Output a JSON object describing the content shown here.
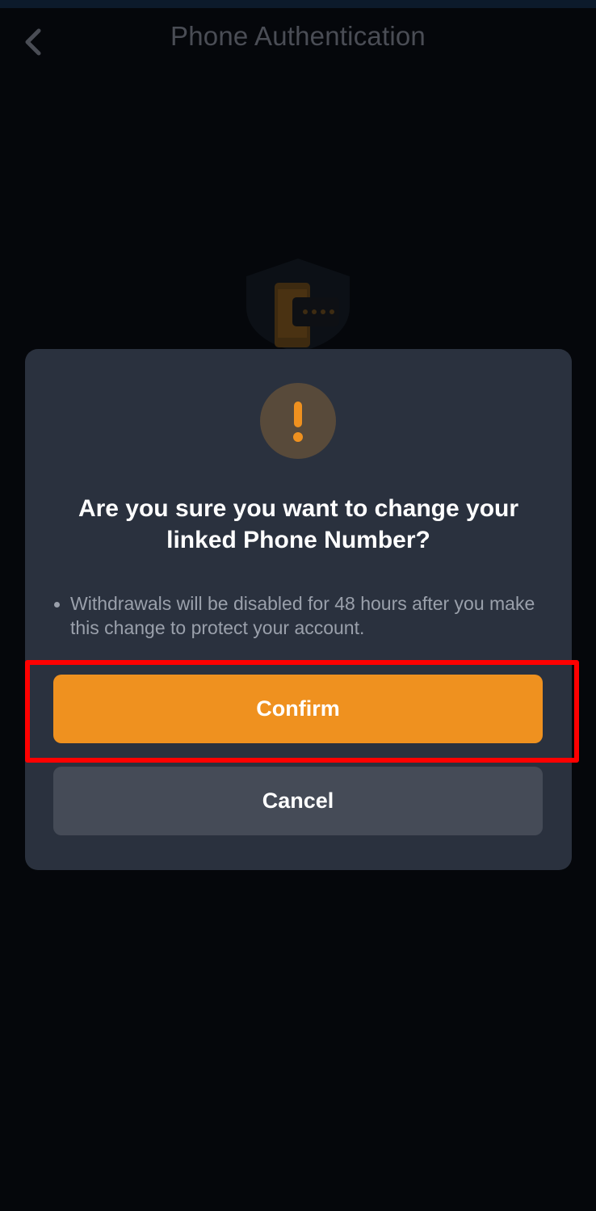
{
  "header": {
    "title": "Phone Authentication",
    "back_icon": "chevron-left-icon"
  },
  "hero": {
    "icon": "phone-shield-icon"
  },
  "dialog": {
    "icon": "exclamation-icon",
    "title": "Are you sure you want to change your linked Phone Number?",
    "note": "Withdrawals will be disabled for 48 hours after you make this change to protect your account.",
    "confirm_label": "Confirm",
    "cancel_label": "Cancel"
  },
  "colors": {
    "background": "#05070b",
    "dialog": "#2a313e",
    "accent": "#ef911f",
    "cancel": "#454b57",
    "highlight": "#ff0000"
  }
}
